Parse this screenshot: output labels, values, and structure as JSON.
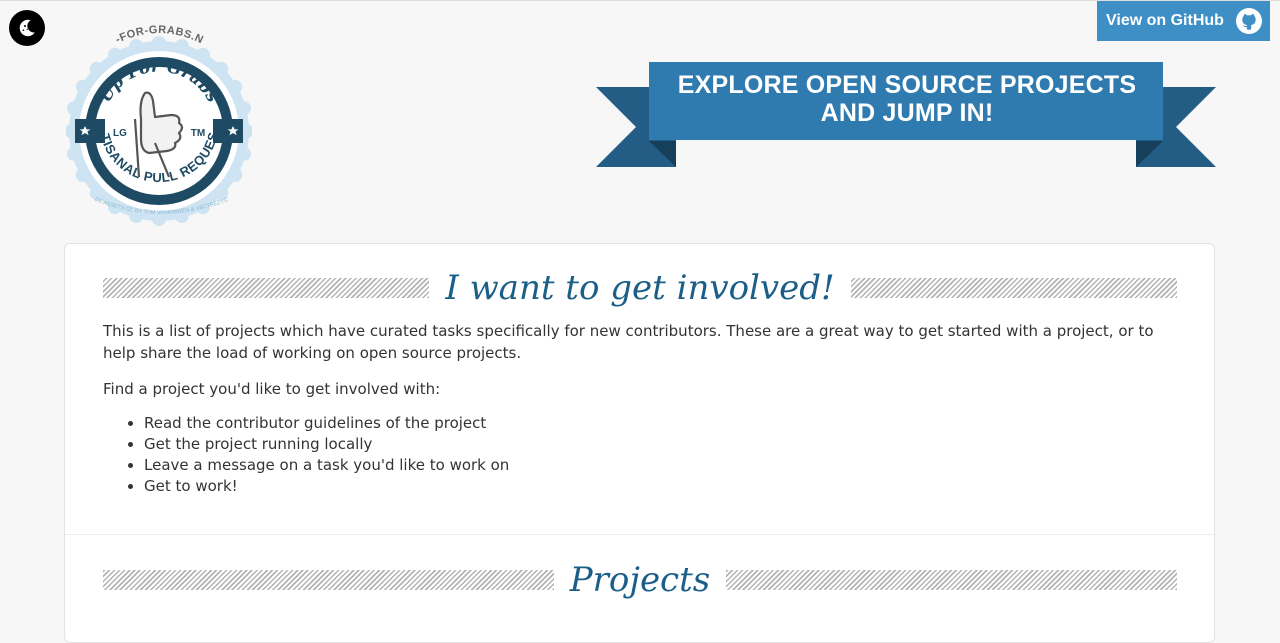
{
  "header": {
    "github_label": "View on GitHub",
    "banner_text": "EXPLORE OPEN SOURCE PROJECTS AND JUMP IN!"
  },
  "logo": {
    "site_name": "UP-FOR-GRABS.NET",
    "title": "Up For Grabs",
    "left_tag": "LG",
    "right_tag": "TM",
    "tagline": "ARTISANAL PULL REQUESTS",
    "credit": "CODE ASSETS CC BY TOM VANKNIWEN & VECTEEZY.COM"
  },
  "intro": {
    "heading": "I want to get involved!",
    "description": "This is a list of projects which have curated tasks specifically for new contributors. These are a great way to get started with a project, or to help share the load of working on open source projects.",
    "prompt": "Find a project you'd like to get involved with:",
    "steps": [
      "Read the contributor guidelines of the project",
      "Get the project running locally",
      "Leave a message on a task you'd like to work on",
      "Get to work!"
    ]
  },
  "projects": {
    "heading": "Projects"
  },
  "icons": {
    "theme_toggle": "moon-icon",
    "github": "github-octocat-icon"
  },
  "colors": {
    "accent": "#3d8fc6",
    "banner": "#2f7bb0",
    "banner_dark": "#1f5a82",
    "heading": "#1b5f89"
  }
}
